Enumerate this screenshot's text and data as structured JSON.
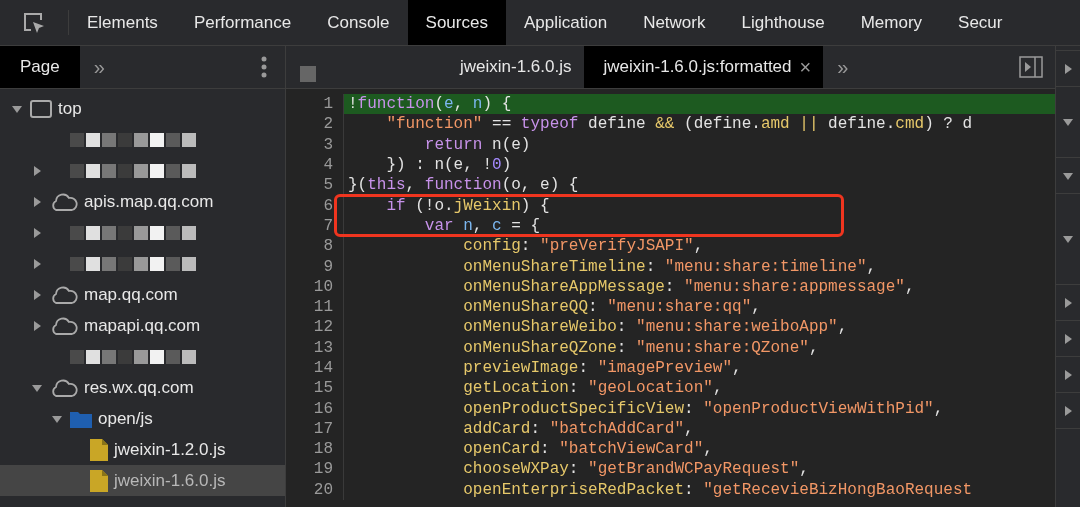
{
  "main_tabs": [
    {
      "label": "Elements",
      "selected": false
    },
    {
      "label": "Performance",
      "selected": false
    },
    {
      "label": "Console",
      "selected": false
    },
    {
      "label": "Sources",
      "selected": true
    },
    {
      "label": "Application",
      "selected": false
    },
    {
      "label": "Network",
      "selected": false
    },
    {
      "label": "Lighthouse",
      "selected": false
    },
    {
      "label": "Memory",
      "selected": false
    },
    {
      "label": "Secur",
      "selected": false
    }
  ],
  "navigator": {
    "tabs": [
      {
        "label": "Page",
        "selected": true
      }
    ],
    "more": "»",
    "tree": [
      {
        "kind": "frame",
        "label": "top",
        "expanded": true,
        "selected": false,
        "children": [
          {
            "kind": "redacted",
            "selected": false
          },
          {
            "kind": "redacted",
            "expanded": false,
            "selected": false
          },
          {
            "kind": "cloud",
            "label": "apis.map.qq.com",
            "expanded": false,
            "selected": false
          },
          {
            "kind": "redacted",
            "expanded": false,
            "selected": false
          },
          {
            "kind": "redacted",
            "expanded": false,
            "selected": false
          },
          {
            "kind": "cloud",
            "label": "map.qq.com",
            "expanded": false,
            "selected": false
          },
          {
            "kind": "cloud",
            "label": "mapapi.qq.com",
            "expanded": false,
            "selected": false
          },
          {
            "kind": "redacted",
            "selected": false
          },
          {
            "kind": "cloud",
            "label": "res.wx.qq.com",
            "expanded": true,
            "selected": false,
            "children": [
              {
                "kind": "folder",
                "label": "open/js",
                "expanded": true,
                "selected": false,
                "children": [
                  {
                    "kind": "file",
                    "label": "jweixin-1.2.0.js",
                    "selected": false
                  },
                  {
                    "kind": "file",
                    "label": "jweixin-1.6.0.js",
                    "selected": true
                  }
                ]
              }
            ]
          }
        ]
      }
    ]
  },
  "editor": {
    "tabs": [
      {
        "label": "jweixin-1.6.0.js",
        "selected": false,
        "closable": false
      },
      {
        "label": "jweixin-1.6.0.js:formatted",
        "selected": true,
        "closable": true
      }
    ],
    "close": "×",
    "more": "»",
    "lines": [
      {
        "number": "1",
        "highlighted": true,
        "boxed": false,
        "tokens": [
          {
            "kind": "plain",
            "text": "!"
          },
          {
            "kind": "kw",
            "text": "function"
          },
          {
            "kind": "plain",
            "text": "("
          },
          {
            "kind": "var",
            "text": "e"
          },
          {
            "kind": "plain",
            "text": ", "
          },
          {
            "kind": "var",
            "text": "n"
          },
          {
            "kind": "plain",
            "text": ") {"
          }
        ]
      },
      {
        "number": "2",
        "highlighted": false,
        "boxed": false,
        "tokens": [
          {
            "kind": "str",
            "text": "    \"function\""
          },
          {
            "kind": "plain",
            "text": " == "
          },
          {
            "kind": "kw",
            "text": "typeof"
          },
          {
            "kind": "plain",
            "text": " define "
          },
          {
            "kind": "prop",
            "text": "&&"
          },
          {
            "kind": "plain",
            "text": " (define."
          },
          {
            "kind": "prop",
            "text": "amd"
          },
          {
            "kind": "prop",
            "text": " ||"
          },
          {
            "kind": "plain",
            "text": " define."
          },
          {
            "kind": "prop",
            "text": "cmd"
          },
          {
            "kind": "plain",
            "text": ") ? d"
          }
        ]
      },
      {
        "number": "3",
        "highlighted": false,
        "boxed": false,
        "tokens": [
          {
            "kind": "kw",
            "text": "        return"
          },
          {
            "kind": "plain",
            "text": " n(e)"
          }
        ]
      },
      {
        "number": "4",
        "highlighted": false,
        "boxed": false,
        "tokens": [
          {
            "kind": "plain",
            "text": "    }) : n(e, !"
          },
          {
            "kind": "num",
            "text": "0"
          },
          {
            "kind": "plain",
            "text": ")"
          }
        ]
      },
      {
        "number": "5",
        "highlighted": false,
        "boxed": false,
        "tokens": [
          {
            "kind": "plain",
            "text": "}("
          },
          {
            "kind": "kw",
            "text": "this"
          },
          {
            "kind": "plain",
            "text": ", "
          },
          {
            "kind": "kw",
            "text": "function"
          },
          {
            "kind": "plain",
            "text": "(o, e) {"
          }
        ]
      },
      {
        "number": "6",
        "highlighted": false,
        "boxed": true,
        "tokens": [
          {
            "kind": "kw",
            "text": "    if"
          },
          {
            "kind": "plain",
            "text": " (!o."
          },
          {
            "kind": "prop",
            "text": "jWeixin"
          },
          {
            "kind": "plain",
            "text": ") {"
          }
        ]
      },
      {
        "number": "7",
        "highlighted": false,
        "boxed": true,
        "tokens": [
          {
            "kind": "kw",
            "text": "        var"
          },
          {
            "kind": "var",
            "text": " n"
          },
          {
            "kind": "plain",
            "text": ", "
          },
          {
            "kind": "var",
            "text": "c"
          },
          {
            "kind": "plain",
            "text": " = {"
          }
        ]
      },
      {
        "number": "8",
        "highlighted": false,
        "boxed": false,
        "tokens": [
          {
            "kind": "prop",
            "text": "            config"
          },
          {
            "kind": "plain",
            "text": ": "
          },
          {
            "kind": "str",
            "text": "\"preVerifyJSAPI\""
          },
          {
            "kind": "plain",
            "text": ","
          }
        ]
      },
      {
        "number": "9",
        "highlighted": false,
        "boxed": false,
        "tokens": [
          {
            "kind": "prop",
            "text": "            onMenuShareTimeline"
          },
          {
            "kind": "plain",
            "text": ": "
          },
          {
            "kind": "str",
            "text": "\"menu:share:timeline\""
          },
          {
            "kind": "plain",
            "text": ","
          }
        ]
      },
      {
        "number": "10",
        "highlighted": false,
        "boxed": false,
        "tokens": [
          {
            "kind": "prop",
            "text": "            onMenuShareAppMessage"
          },
          {
            "kind": "plain",
            "text": ": "
          },
          {
            "kind": "str",
            "text": "\"menu:share:appmessage\""
          },
          {
            "kind": "plain",
            "text": ","
          }
        ]
      },
      {
        "number": "11",
        "highlighted": false,
        "boxed": false,
        "tokens": [
          {
            "kind": "prop",
            "text": "            onMenuShareQQ"
          },
          {
            "kind": "plain",
            "text": ": "
          },
          {
            "kind": "str",
            "text": "\"menu:share:qq\""
          },
          {
            "kind": "plain",
            "text": ","
          }
        ]
      },
      {
        "number": "12",
        "highlighted": false,
        "boxed": false,
        "tokens": [
          {
            "kind": "prop",
            "text": "            onMenuShareWeibo"
          },
          {
            "kind": "plain",
            "text": ": "
          },
          {
            "kind": "str",
            "text": "\"menu:share:weiboApp\""
          },
          {
            "kind": "plain",
            "text": ","
          }
        ]
      },
      {
        "number": "13",
        "highlighted": false,
        "boxed": false,
        "tokens": [
          {
            "kind": "prop",
            "text": "            onMenuShareQZone"
          },
          {
            "kind": "plain",
            "text": ": "
          },
          {
            "kind": "str",
            "text": "\"menu:share:QZone\""
          },
          {
            "kind": "plain",
            "text": ","
          }
        ]
      },
      {
        "number": "14",
        "highlighted": false,
        "boxed": false,
        "tokens": [
          {
            "kind": "prop",
            "text": "            previewImage"
          },
          {
            "kind": "plain",
            "text": ": "
          },
          {
            "kind": "str",
            "text": "\"imagePreview\""
          },
          {
            "kind": "plain",
            "text": ","
          }
        ]
      },
      {
        "number": "15",
        "highlighted": false,
        "boxed": false,
        "tokens": [
          {
            "kind": "prop",
            "text": "            getLocation"
          },
          {
            "kind": "plain",
            "text": ": "
          },
          {
            "kind": "str",
            "text": "\"geoLocation\""
          },
          {
            "kind": "plain",
            "text": ","
          }
        ]
      },
      {
        "number": "16",
        "highlighted": false,
        "boxed": false,
        "tokens": [
          {
            "kind": "prop",
            "text": "            openProductSpecificView"
          },
          {
            "kind": "plain",
            "text": ": "
          },
          {
            "kind": "str",
            "text": "\"openProductViewWithPid\""
          },
          {
            "kind": "plain",
            "text": ","
          }
        ]
      },
      {
        "number": "17",
        "highlighted": false,
        "boxed": false,
        "tokens": [
          {
            "kind": "prop",
            "text": "            addCard"
          },
          {
            "kind": "plain",
            "text": ": "
          },
          {
            "kind": "str",
            "text": "\"batchAddCard\""
          },
          {
            "kind": "plain",
            "text": ","
          }
        ]
      },
      {
        "number": "18",
        "highlighted": false,
        "boxed": false,
        "tokens": [
          {
            "kind": "prop",
            "text": "            openCard"
          },
          {
            "kind": "plain",
            "text": ": "
          },
          {
            "kind": "str",
            "text": "\"batchViewCard\""
          },
          {
            "kind": "plain",
            "text": ","
          }
        ]
      },
      {
        "number": "19",
        "highlighted": false,
        "boxed": false,
        "tokens": [
          {
            "kind": "prop",
            "text": "            chooseWXPay"
          },
          {
            "kind": "plain",
            "text": ": "
          },
          {
            "kind": "str",
            "text": "\"getBrandWCPayRequest\""
          },
          {
            "kind": "plain",
            "text": ","
          }
        ]
      },
      {
        "number": "20",
        "highlighted": false,
        "boxed": false,
        "tokens": [
          {
            "kind": "prop",
            "text": "            openEnterpriseRedPacket"
          },
          {
            "kind": "plain",
            "text": ": "
          },
          {
            "kind": "str",
            "text": "\"getRecevieBizHongBaoRequest"
          }
        ]
      }
    ]
  },
  "sidebar_sections": [
    {
      "expanded": false
    },
    {
      "expanded": true
    },
    {
      "expanded": true
    },
    {
      "expanded": true
    },
    {
      "expanded": false
    },
    {
      "expanded": false
    },
    {
      "expanded": false
    },
    {
      "expanded": false
    }
  ]
}
